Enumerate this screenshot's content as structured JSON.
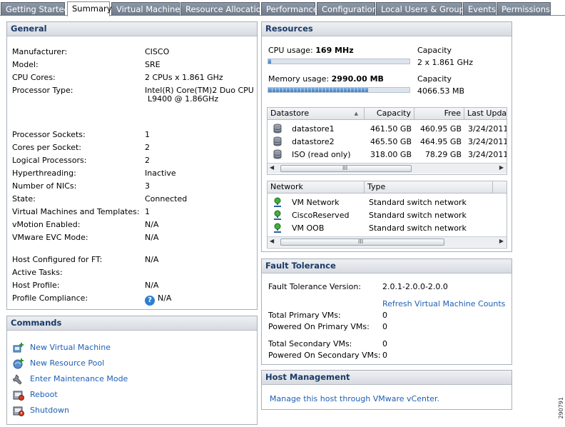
{
  "tabs": [
    "Getting Started",
    "Summary",
    "Virtual Machines",
    "Resource Allocation",
    "Performance",
    "Configuration",
    "Local Users & Groups",
    "Events",
    "Permissions"
  ],
  "active_tab": "Summary",
  "general": {
    "title": "General",
    "rows": [
      {
        "label": "Manufacturer:",
        "value": "CISCO"
      },
      {
        "label": "Model:",
        "value": "SRE"
      },
      {
        "label": "CPU Cores:",
        "value": "2 CPUs x 1.861 GHz"
      },
      {
        "label": "Processor Type:",
        "value": "Intel(R) Core(TM)2 Duo CPU",
        "value2": "L9400  @ 1.86GHz"
      },
      {
        "label": "Processor Sockets:",
        "value": "1"
      },
      {
        "label": "Cores per Socket:",
        "value": "2"
      },
      {
        "label": "Logical Processors:",
        "value": "2"
      },
      {
        "label": "Hyperthreading:",
        "value": "Inactive"
      },
      {
        "label": "Number of NICs:",
        "value": "3"
      },
      {
        "label": "State:",
        "value": "Connected"
      },
      {
        "label": "Virtual Machines and Templates:",
        "value": "1"
      },
      {
        "label": "vMotion Enabled:",
        "value": "N/A"
      },
      {
        "label": "VMware EVC Mode:",
        "value": "N/A"
      },
      {
        "label": "Host Configured for FT:",
        "value": "N/A"
      },
      {
        "label": "Active Tasks:",
        "value": ""
      },
      {
        "label": "Host Profile:",
        "value": "N/A"
      },
      {
        "label": "Profile Compliance:",
        "value": "N/A"
      }
    ]
  },
  "commands": {
    "title": "Commands",
    "items": [
      {
        "label": "New Virtual Machine",
        "icon": "new-vm-icon"
      },
      {
        "label": "New Resource Pool",
        "icon": "resource-pool-icon"
      },
      {
        "label": "Enter Maintenance Mode",
        "icon": "maintenance-icon"
      },
      {
        "label": "Reboot",
        "icon": "reboot-icon"
      },
      {
        "label": "Shutdown",
        "icon": "shutdown-icon"
      }
    ]
  },
  "resources": {
    "title": "Resources",
    "cpu_label": "CPU usage:",
    "cpu_value": "169 MHz",
    "cpu_fraction": 0.02,
    "cpu_cap_label": "Capacity",
    "cpu_cap_value": "2 x 1.861 GHz",
    "mem_label": "Memory usage:",
    "mem_value": "2990.00 MB",
    "mem_fraction": 0.705,
    "mem_cap_label": "Capacity",
    "mem_cap_value": "4066.53 MB",
    "datastore_headers": [
      "Datastore",
      "Capacity",
      "Free",
      "Last Updat"
    ],
    "datastores": [
      {
        "name": "datastore1",
        "capacity": "461.50 GB",
        "free": "460.95 GB",
        "updated": "3/24/2011"
      },
      {
        "name": "datastore2",
        "capacity": "465.50 GB",
        "free": "464.95 GB",
        "updated": "3/24/2011"
      },
      {
        "name": "ISO (read only)",
        "capacity": "318.00 GB",
        "free": "78.29 GB",
        "updated": "3/24/2011"
      }
    ],
    "network_headers": [
      "Network",
      "Type"
    ],
    "networks": [
      {
        "name": "VM Network",
        "type": "Standard switch network"
      },
      {
        "name": "CiscoReserved",
        "type": "Standard switch network"
      },
      {
        "name": "VM OOB",
        "type": "Standard switch network"
      }
    ],
    "scroll_grip": "III"
  },
  "fault_tolerance": {
    "title": "Fault Tolerance",
    "version_label": "Fault Tolerance Version:",
    "version_value": "2.0.1-2.0.0-2.0.0",
    "refresh_link": "Refresh Virtual Machine Counts",
    "rows": [
      {
        "label": "Total Primary VMs:",
        "value": "0"
      },
      {
        "label": "Powered On Primary VMs:",
        "value": "0"
      },
      {
        "label": "Total Secondary VMs:",
        "value": "0"
      },
      {
        "label": "Powered On Secondary VMs:",
        "value": "0"
      }
    ]
  },
  "host_management": {
    "title": "Host Management",
    "link": "Manage this host through VMware vCenter."
  },
  "figure_id": "290791",
  "colors": {
    "link": "#1f5fb4",
    "header_text": "#1b3a66",
    "tab_bg": "#7a8594"
  }
}
